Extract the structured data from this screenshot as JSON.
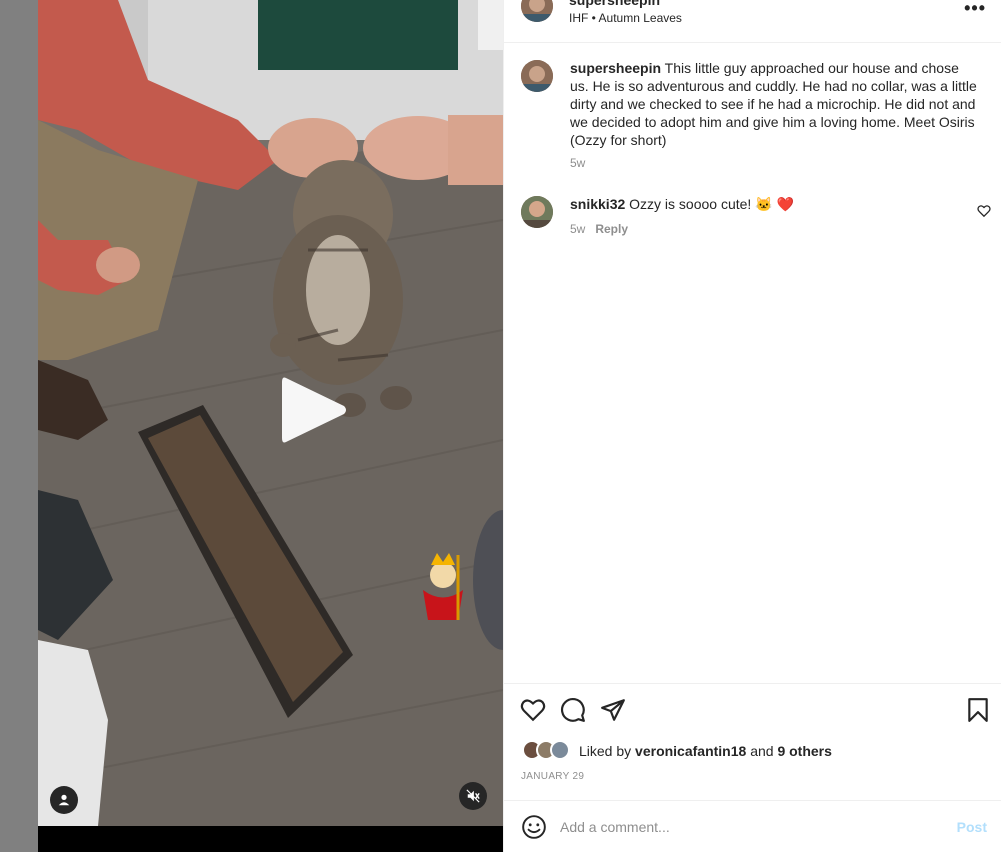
{
  "post": {
    "username": "supersheepin",
    "subtitle": "IHF • Autumn Leaves",
    "more_label": "•••"
  },
  "caption": {
    "username": "supersheepin",
    "text": "This little guy approached our house and chose us. He is so adventurous and cuddly. He had no collar, was a little dirty and we checked to see if he had a microchip. He did not and we decided to adopt him and give him a loving home. Meet Osiris (Ozzy for short)",
    "time": "5w"
  },
  "comments": [
    {
      "username": "snikki32",
      "text": "Ozzy is soooo cute! 🐱 ❤️",
      "time": "5w",
      "reply_label": "Reply"
    }
  ],
  "likes": {
    "prefix": "Liked by",
    "user": "veronicafantin18",
    "joiner": "and",
    "others": "9 others"
  },
  "date": "JANUARY 29",
  "add_comment": {
    "placeholder": "Add a comment...",
    "post_label": "Post"
  },
  "media": {
    "type": "video",
    "state": "paused",
    "muted": true
  },
  "colors": {
    "accent_disabled": "#b2dffc",
    "text_primary": "#262626",
    "text_secondary": "#8e8e8e",
    "divider": "#efefef"
  },
  "icons": [
    "more-icon",
    "heart-icon",
    "comment-icon",
    "share-icon",
    "bookmark-icon",
    "emoji-icon",
    "play-icon",
    "user-tag-icon",
    "muted-speaker-icon"
  ]
}
